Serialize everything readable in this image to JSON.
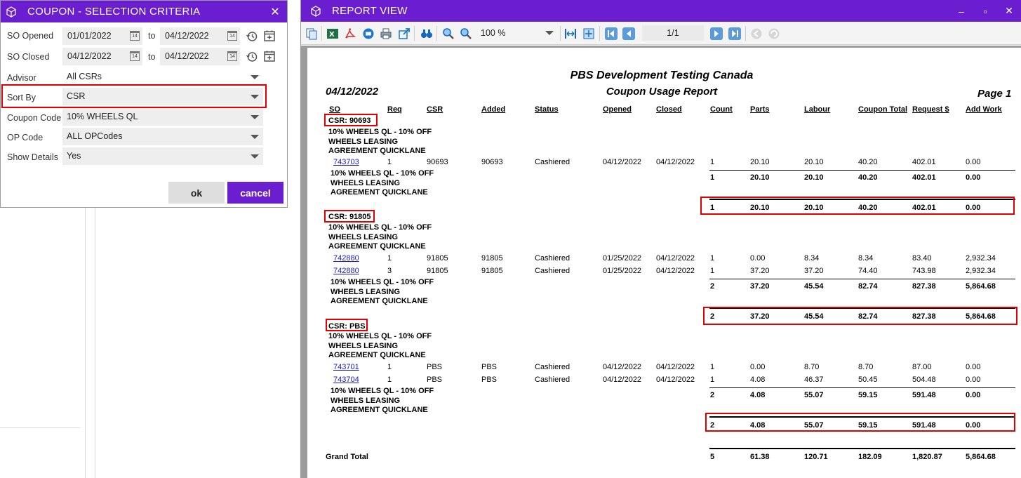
{
  "coupon": {
    "title": "COUPON - SELECTION CRITERIA",
    "so_opened_label": "SO Opened",
    "so_opened_from": "01/01/2022",
    "so_opened_to": "04/12/2022",
    "so_closed_label": "SO Closed",
    "so_closed_from": "04/12/2022",
    "so_closed_to": "04/12/2022",
    "to_label": "to",
    "cal_day": "14",
    "advisor_label": "Advisor",
    "advisor_value": "All CSRs",
    "sortby_label": "Sort By",
    "sortby_value": "CSR",
    "couponcode_label": "Coupon Code",
    "couponcode_value": "10% WHEELS QL",
    "opcode_label": "OP Code",
    "opcode_value": "ALL OPCodes",
    "showdetails_label": "Show Details",
    "showdetails_value": "Yes",
    "ok_label": "ok",
    "cancel_label": "cancel"
  },
  "report_window": {
    "title": "REPORT VIEW",
    "zoom": "100 %",
    "page_indicator": "1/1"
  },
  "report": {
    "company": "PBS Development Testing Canada",
    "date": "04/12/2022",
    "title": "Coupon Usage Report",
    "page": "Page 1",
    "columns": [
      "SO",
      "Req",
      "CSR",
      "Added",
      "Status",
      "Opened",
      "Closed",
      "Count",
      "Parts",
      "Labour",
      "Coupon Total",
      "Request $",
      "Add Work"
    ],
    "coupon_desc": [
      "10% WHEELS QL - 10% OFF",
      "WHEELS LEASING",
      "AGREEMENT QUICKLANE"
    ],
    "groups": [
      {
        "csr": "CSR: 90693",
        "rows": [
          {
            "so": "743703",
            "req": "1",
            "csr": "90693",
            "added": "90693",
            "status": "Cashiered",
            "opened": "04/12/2022",
            "closed": "04/12/2022",
            "count": "1",
            "parts": "20.10",
            "labour": "20.10",
            "coupon_total": "40.20",
            "request": "402.01",
            "add_work": "0.00"
          }
        ],
        "subtotal": {
          "count": "1",
          "parts": "20.10",
          "labour": "20.10",
          "coupon_total": "40.20",
          "request": "402.01",
          "add_work": "0.00"
        },
        "total": {
          "count": "1",
          "parts": "20.10",
          "labour": "20.10",
          "coupon_total": "40.20",
          "request": "402.01",
          "add_work": "0.00"
        }
      },
      {
        "csr": "CSR: 91805",
        "rows": [
          {
            "so": "742880",
            "req": "1",
            "csr": "91805",
            "added": "91805",
            "status": "Cashiered",
            "opened": "01/25/2022",
            "closed": "04/12/2022",
            "count": "1",
            "parts": "0.00",
            "labour": "8.34",
            "coupon_total": "8.34",
            "request": "83.40",
            "add_work": "2,932.34"
          },
          {
            "so": "742880",
            "req": "3",
            "csr": "91805",
            "added": "91805",
            "status": "Cashiered",
            "opened": "01/25/2022",
            "closed": "04/12/2022",
            "count": "1",
            "parts": "37.20",
            "labour": "37.20",
            "coupon_total": "74.40",
            "request": "743.98",
            "add_work": "2,932.34"
          }
        ],
        "subtotal": {
          "count": "2",
          "parts": "37.20",
          "labour": "45.54",
          "coupon_total": "82.74",
          "request": "827.38",
          "add_work": "5,864.68"
        },
        "total": {
          "count": "2",
          "parts": "37.20",
          "labour": "45.54",
          "coupon_total": "82.74",
          "request": "827.38",
          "add_work": "5,864.68"
        }
      },
      {
        "csr": "CSR: PBS",
        "rows": [
          {
            "so": "743701",
            "req": "1",
            "csr": "PBS",
            "added": "PBS",
            "status": "Cashiered",
            "opened": "04/12/2022",
            "closed": "04/12/2022",
            "count": "1",
            "parts": "0.00",
            "labour": "8.70",
            "coupon_total": "8.70",
            "request": "87.00",
            "add_work": "0.00"
          },
          {
            "so": "743704",
            "req": "1",
            "csr": "PBS",
            "added": "PBS",
            "status": "Cashiered",
            "opened": "04/12/2022",
            "closed": "04/12/2022",
            "count": "1",
            "parts": "4.08",
            "labour": "46.37",
            "coupon_total": "50.45",
            "request": "504.48",
            "add_work": "0.00"
          }
        ],
        "subtotal": {
          "count": "2",
          "parts": "4.08",
          "labour": "55.07",
          "coupon_total": "59.15",
          "request": "591.48",
          "add_work": "0.00"
        },
        "total": {
          "count": "2",
          "parts": "4.08",
          "labour": "55.07",
          "coupon_total": "59.15",
          "request": "591.48",
          "add_work": "0.00"
        }
      }
    ],
    "grand_total_label": "Grand Total",
    "grand_total": {
      "count": "5",
      "parts": "61.38",
      "labour": "120.71",
      "coupon_total": "182.09",
      "request": "1,820.87",
      "add_work": "5,864.68"
    }
  }
}
